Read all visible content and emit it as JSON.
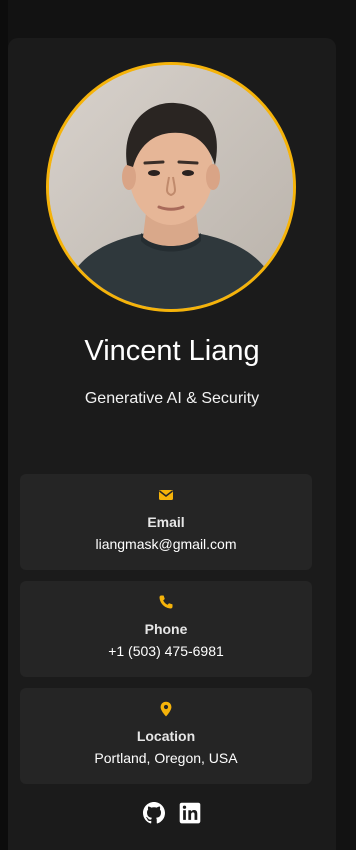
{
  "profile": {
    "name": "Vincent Liang",
    "subtitle": "Generative AI & Security",
    "avatar_icon": "profile-photo",
    "accent_color": "#f5b30a"
  },
  "contacts": [
    {
      "label": "Email",
      "value": "liangmask@gmail.com",
      "icon": "envelope-icon"
    },
    {
      "label": "Phone",
      "value": "+1 (503) 475-6981",
      "icon": "phone-icon"
    },
    {
      "label": "Location",
      "value": "Portland, Oregon, USA",
      "icon": "location-pin-icon"
    }
  ],
  "socials": [
    {
      "icon": "github-icon"
    },
    {
      "icon": "linkedin-icon"
    }
  ]
}
